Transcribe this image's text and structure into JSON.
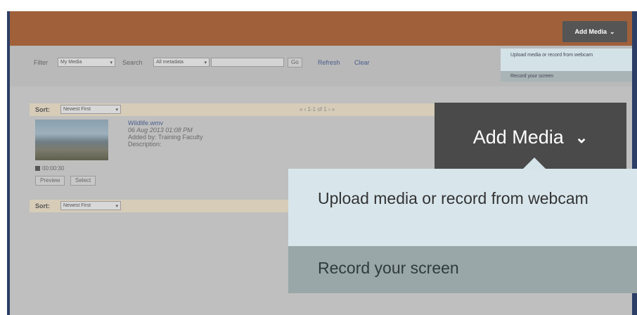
{
  "header": {
    "add_media_label": "Add Media"
  },
  "filterbar": {
    "filter_label": "Filter",
    "filter_value": "My Media",
    "search_label": "Search",
    "search_scope": "All metadata",
    "search_value": "",
    "go_label": "Go",
    "refresh_label": "Refresh",
    "clear_label": "Clear"
  },
  "small_dropdown": {
    "item1": "Upload media or record from webcam",
    "item2": "Record your screen"
  },
  "sort": {
    "label": "Sort:",
    "value": "Newest First",
    "pager": "« ‹ 1-1 of 1 › »"
  },
  "media": {
    "title": "Wildlife.wmv",
    "date": "06 Aug 2013 01:08 PM",
    "added_by": "Added by: Training Faculty",
    "description": "Description:",
    "duration": "00:00:30",
    "preview_label": "Preview",
    "select_label": "Select"
  },
  "zoom": {
    "add_media_label": "Add Media",
    "item1": "Upload media or record from webcam",
    "item2": "Record your screen"
  }
}
